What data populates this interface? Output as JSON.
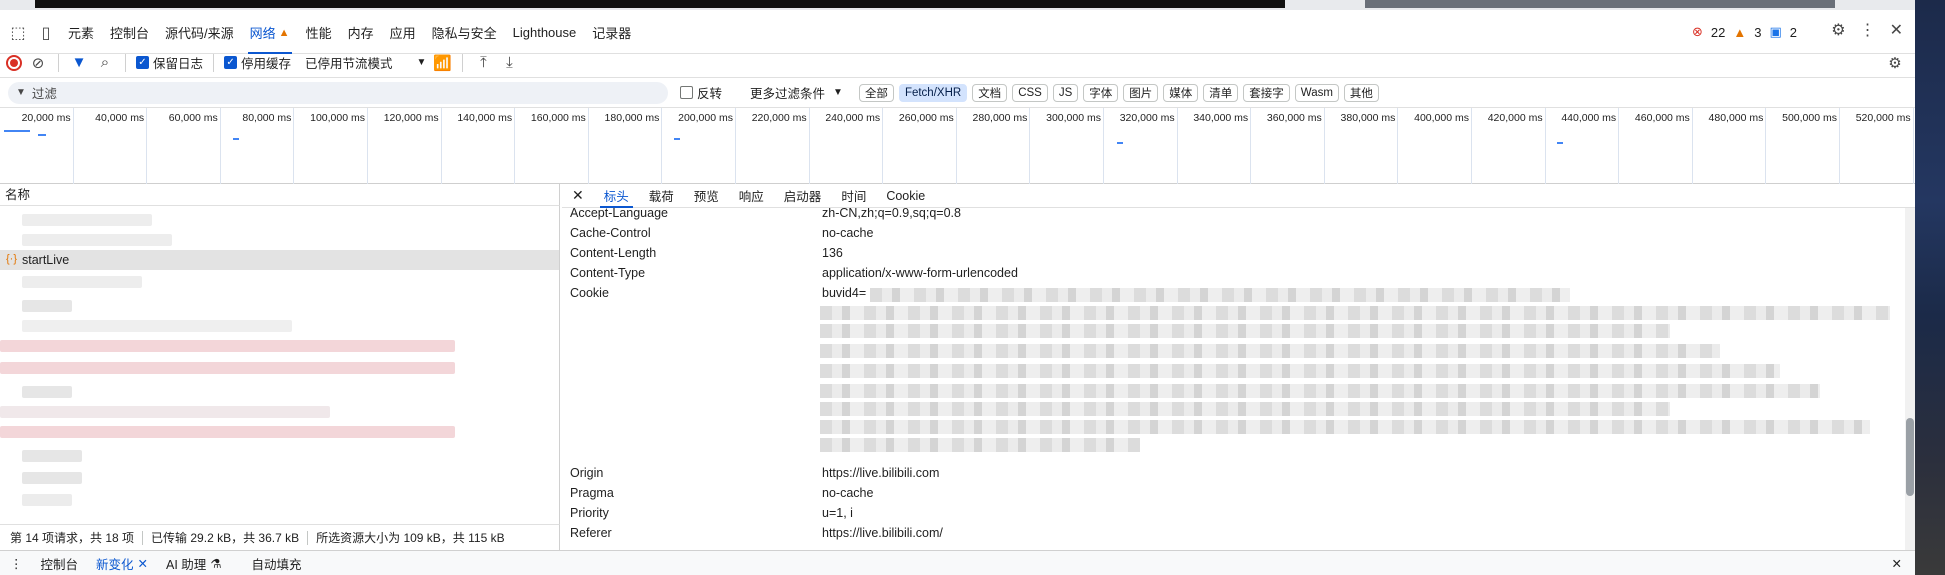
{
  "tabs": {
    "items": [
      "元素",
      "控制台",
      "源代码/来源",
      "网络",
      "性能",
      "内存",
      "应用",
      "隐私与安全",
      "Lighthouse",
      "记录器"
    ],
    "active": "网络"
  },
  "badges": {
    "errors": "22",
    "warnings": "3",
    "info": "2"
  },
  "toolbar": {
    "preserve_log": "保留日志",
    "disable_cache": "停用缓存",
    "throttle": "已停用节流模式"
  },
  "filter": {
    "placeholder": "过滤",
    "invert": "反转",
    "more_filters": "更多过滤条件",
    "chips": [
      "全部",
      "Fetch/XHR",
      "文档",
      "CSS",
      "JS",
      "字体",
      "图片",
      "媒体",
      "清单",
      "套接字",
      "Wasm",
      "其他"
    ],
    "active_chip": "Fetch/XHR"
  },
  "timeline": {
    "ticks": [
      "20,000 ms",
      "40,000 ms",
      "60,000 ms",
      "80,000 ms",
      "100,000 ms",
      "120,000 ms",
      "140,000 ms",
      "160,000 ms",
      "180,000 ms",
      "200,000 ms",
      "220,000 ms",
      "240,000 ms",
      "260,000 ms",
      "280,000 ms",
      "300,000 ms",
      "320,000 ms",
      "340,000 ms",
      "360,000 ms",
      "380,000 ms",
      "400,000 ms",
      "420,000 ms",
      "440,000 ms",
      "460,000 ms",
      "480,000 ms",
      "500,000 ms",
      "520,000 ms"
    ]
  },
  "list": {
    "header": "名称",
    "selected_request": "startLive"
  },
  "status": {
    "requests": "第 14 项请求，共 18 项",
    "transferred": "已传输 29.2 kB，共 36.7 kB",
    "resources": "所选资源大小为 109 kB，共 115 kB"
  },
  "detail": {
    "tabs": [
      "标头",
      "载荷",
      "预览",
      "响应",
      "启动器",
      "时间",
      "Cookie"
    ],
    "active_tab": "标头",
    "headers": [
      {
        "name": "Accept-Language",
        "value": "zh-CN,zh;q=0.9,sq;q=0.8"
      },
      {
        "name": "Cache-Control",
        "value": "no-cache"
      },
      {
        "name": "Content-Length",
        "value": "136"
      },
      {
        "name": "Content-Type",
        "value": "application/x-www-form-urlencoded"
      },
      {
        "name": "Cookie",
        "value": "buvid4="
      },
      {
        "name": "Origin",
        "value": "https://live.bilibili.com"
      },
      {
        "name": "Pragma",
        "value": "no-cache"
      },
      {
        "name": "Priority",
        "value": "u=1, i"
      },
      {
        "name": "Referer",
        "value": "https://live.bilibili.com/"
      }
    ]
  },
  "drawer": {
    "items": [
      "控制台",
      "新变化",
      "AI 助理",
      "自动填充"
    ],
    "active": "新变化"
  }
}
